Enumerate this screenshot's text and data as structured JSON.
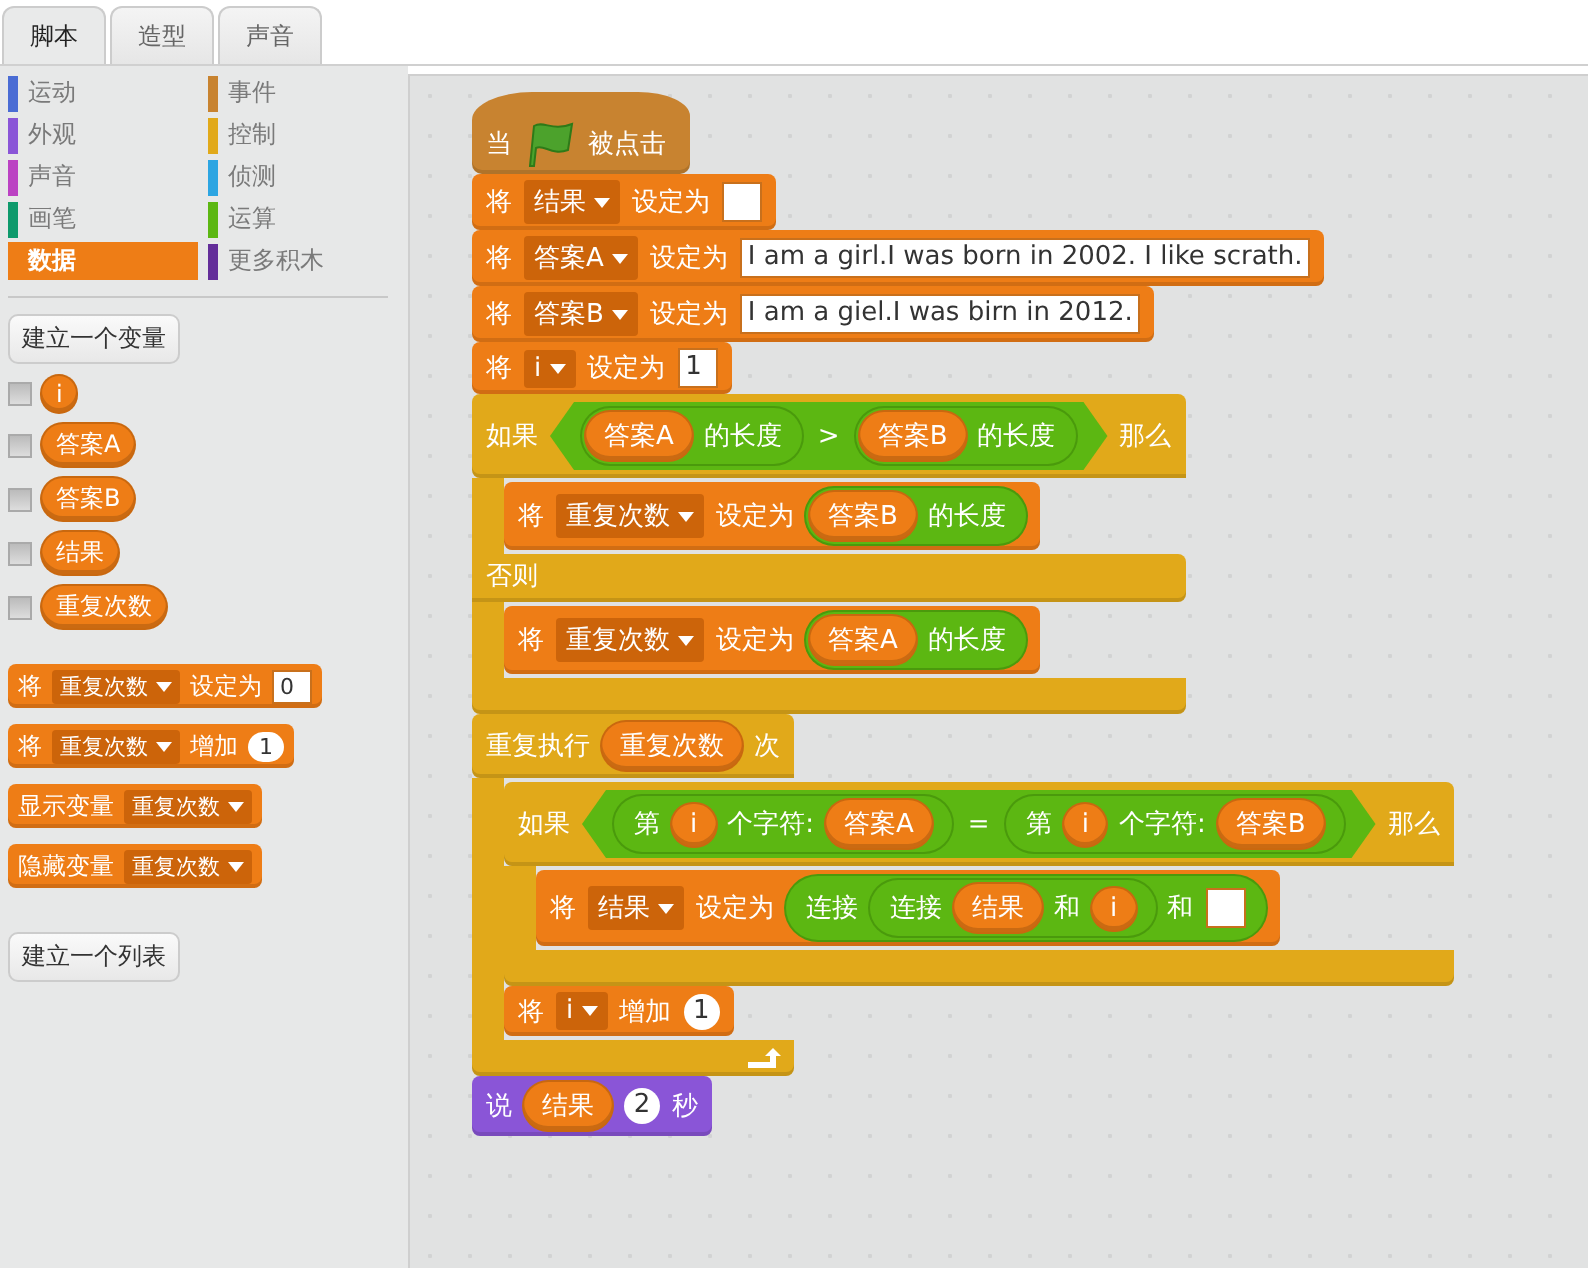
{
  "tabs": [
    {
      "label": "脚本",
      "selected": true
    },
    {
      "label": "造型",
      "selected": false
    },
    {
      "label": "声音",
      "selected": false
    }
  ],
  "palette": {
    "categories": [
      {
        "label": "运动",
        "color": "#4a6cd4",
        "selected": false
      },
      {
        "label": "外观",
        "color": "#8a55d7",
        "selected": false
      },
      {
        "label": "声音",
        "color": "#bb42c3",
        "selected": false
      },
      {
        "label": "画笔",
        "color": "#0e9a6c",
        "selected": false
      },
      {
        "label": "数据",
        "color": "#ee7d16",
        "selected": true
      },
      {
        "label": "事件",
        "color": "#c88330",
        "selected": false
      },
      {
        "label": "控制",
        "color": "#e1a91a",
        "selected": false
      },
      {
        "label": "侦测",
        "color": "#2ca5e2",
        "selected": false
      },
      {
        "label": "运算",
        "color": "#5cb712",
        "selected": false
      },
      {
        "label": "更多积木",
        "color": "#632d99",
        "selected": false
      }
    ],
    "make_variable_button": "建立一个变量",
    "variables": [
      {
        "name": "i",
        "checked": false
      },
      {
        "name": "答案A",
        "checked": false
      },
      {
        "name": "答案B",
        "checked": false
      },
      {
        "name": "结果",
        "checked": false
      },
      {
        "name": "重复次数",
        "checked": false
      }
    ],
    "blocks": [
      {
        "kind": "stack",
        "color": "#ee7d16",
        "parts": [
          {
            "kind": "text",
            "text": "将"
          },
          {
            "kind": "dropdown",
            "text": "重复次数"
          },
          {
            "kind": "text",
            "text": "设定为"
          },
          {
            "kind": "text_input",
            "text": "0"
          }
        ]
      },
      {
        "kind": "stack",
        "color": "#ee7d16",
        "parts": [
          {
            "kind": "text",
            "text": "将"
          },
          {
            "kind": "dropdown",
            "text": "重复次数"
          },
          {
            "kind": "text",
            "text": "增加"
          },
          {
            "kind": "number_input",
            "text": "1"
          }
        ]
      },
      {
        "kind": "stack",
        "color": "#ee7d16",
        "parts": [
          {
            "kind": "text",
            "text": "显示变量"
          },
          {
            "kind": "dropdown",
            "text": "重复次数"
          }
        ]
      },
      {
        "kind": "stack",
        "color": "#ee7d16",
        "parts": [
          {
            "kind": "text",
            "text": "隐藏变量"
          },
          {
            "kind": "dropdown",
            "text": "重复次数"
          }
        ]
      }
    ],
    "make_list_button": "建立一个列表"
  },
  "script": [
    {
      "kind": "hat",
      "color": "#c88330",
      "parts": [
        {
          "kind": "text",
          "text": "当"
        },
        {
          "kind": "flag"
        },
        {
          "kind": "text",
          "text": "被点击"
        }
      ]
    },
    {
      "kind": "stack",
      "color": "#ee7d16",
      "parts": [
        {
          "kind": "text",
          "text": "将"
        },
        {
          "kind": "dropdown",
          "text": "结果"
        },
        {
          "kind": "text",
          "text": "设定为"
        },
        {
          "kind": "text_input"
        }
      ]
    },
    {
      "kind": "stack",
      "color": "#ee7d16",
      "parts": [
        {
          "kind": "text",
          "text": "将"
        },
        {
          "kind": "dropdown",
          "text": "答案A"
        },
        {
          "kind": "text",
          "text": "设定为"
        },
        {
          "kind": "text_input",
          "text": "I am a girl.I was born in 2002. I like scrath."
        }
      ]
    },
    {
      "kind": "stack",
      "color": "#ee7d16",
      "parts": [
        {
          "kind": "text",
          "text": "将"
        },
        {
          "kind": "dropdown",
          "text": "答案B"
        },
        {
          "kind": "text",
          "text": "设定为"
        },
        {
          "kind": "text_input",
          "text": "I am a giel.I was birn in 2012."
        }
      ]
    },
    {
      "kind": "stack",
      "color": "#ee7d16",
      "parts": [
        {
          "kind": "text",
          "text": "将"
        },
        {
          "kind": "dropdown",
          "text": "i"
        },
        {
          "kind": "text",
          "text": "设定为"
        },
        {
          "kind": "text_input",
          "text": "1"
        }
      ]
    },
    {
      "kind": "c",
      "color": "#e1a91a",
      "sections": [
        {
          "parts": [
            {
              "kind": "text",
              "text": "如果"
            },
            {
              "kind": "boolean",
              "parts": [
                {
                  "kind": "reporter",
                  "parts": [
                    {
                      "kind": "variable",
                      "text": "答案A"
                    },
                    {
                      "kind": "text",
                      "text": "的长度"
                    }
                  ]
                },
                {
                  "kind": "text",
                  "text": ">"
                },
                {
                  "kind": "reporter",
                  "parts": [
                    {
                      "kind": "variable",
                      "text": "答案B"
                    },
                    {
                      "kind": "text",
                      "text": "的长度"
                    }
                  ]
                }
              ]
            },
            {
              "kind": "text",
              "text": "那么"
            }
          ],
          "body": [
            {
              "kind": "stack",
              "color": "#ee7d16",
              "parts": [
                {
                  "kind": "text",
                  "text": "将"
                },
                {
                  "kind": "dropdown",
                  "text": "重复次数"
                },
                {
                  "kind": "text",
                  "text": "设定为"
                },
                {
                  "kind": "reporter",
                  "parts": [
                    {
                      "kind": "variable",
                      "text": "答案B"
                    },
                    {
                      "kind": "text",
                      "text": "的长度"
                    }
                  ]
                }
              ]
            }
          ]
        },
        {
          "parts": [
            {
              "kind": "text",
              "text": "否则"
            }
          ],
          "body": [
            {
              "kind": "stack",
              "color": "#ee7d16",
              "parts": [
                {
                  "kind": "text",
                  "text": "将"
                },
                {
                  "kind": "dropdown",
                  "text": "重复次数"
                },
                {
                  "kind": "text",
                  "text": "设定为"
                },
                {
                  "kind": "reporter",
                  "parts": [
                    {
                      "kind": "variable",
                      "text": "答案A"
                    },
                    {
                      "kind": "text",
                      "text": "的长度"
                    }
                  ]
                }
              ]
            }
          ]
        }
      ]
    },
    {
      "kind": "c_loop",
      "color": "#e1a91a",
      "sections": [
        {
          "parts": [
            {
              "kind": "text",
              "text": "重复执行"
            },
            {
              "kind": "variable",
              "text": "重复次数"
            },
            {
              "kind": "text",
              "text": "次"
            }
          ],
          "body": [
            {
              "kind": "c",
              "color": "#e1a91a",
              "sections": [
                {
                  "parts": [
                    {
                      "kind": "text",
                      "text": "如果"
                    },
                    {
                      "kind": "boolean",
                      "parts": [
                        {
                          "kind": "reporter",
                          "parts": [
                            {
                              "kind": "text",
                              "text": "第"
                            },
                            {
                              "kind": "variable",
                              "text": "i"
                            },
                            {
                              "kind": "text",
                              "text": "个字符:"
                            },
                            {
                              "kind": "variable",
                              "text": "答案A"
                            }
                          ]
                        },
                        {
                          "kind": "text",
                          "text": "="
                        },
                        {
                          "kind": "reporter",
                          "parts": [
                            {
                              "kind": "text",
                              "text": "第"
                            },
                            {
                              "kind": "variable",
                              "text": "i"
                            },
                            {
                              "kind": "text",
                              "text": "个字符:"
                            },
                            {
                              "kind": "variable",
                              "text": "答案B"
                            }
                          ]
                        }
                      ]
                    },
                    {
                      "kind": "text",
                      "text": "那么"
                    }
                  ],
                  "body": [
                    {
                      "kind": "stack",
                      "color": "#ee7d16",
                      "parts": [
                        {
                          "kind": "text",
                          "text": "将"
                        },
                        {
                          "kind": "dropdown",
                          "text": "结果"
                        },
                        {
                          "kind": "text",
                          "text": "设定为"
                        },
                        {
                          "kind": "reporter",
                          "parts": [
                            {
                              "kind": "text",
                              "text": "连接"
                            },
                            {
                              "kind": "reporter",
                              "parts": [
                                {
                                  "kind": "text",
                                  "text": "连接"
                                },
                                {
                                  "kind": "variable",
                                  "text": "结果"
                                },
                                {
                                  "kind": "text",
                                  "text": "和"
                                },
                                {
                                  "kind": "variable",
                                  "text": "i"
                                }
                              ]
                            },
                            {
                              "kind": "text",
                              "text": "和"
                            },
                            {
                              "kind": "text_input"
                            }
                          ]
                        }
                      ]
                    }
                  ]
                }
              ]
            },
            {
              "kind": "stack",
              "color": "#ee7d16",
              "parts": [
                {
                  "kind": "text",
                  "text": "将"
                },
                {
                  "kind": "dropdown",
                  "text": "i"
                },
                {
                  "kind": "text",
                  "text": "增加"
                },
                {
                  "kind": "number_input",
                  "text": "1"
                }
              ]
            }
          ]
        }
      ]
    },
    {
      "kind": "stack",
      "color": "#8a55d7",
      "parts": [
        {
          "kind": "text",
          "text": "说"
        },
        {
          "kind": "variable",
          "text": "结果"
        },
        {
          "kind": "number_input",
          "text": "2"
        },
        {
          "kind": "text",
          "text": "秒"
        }
      ]
    }
  ]
}
